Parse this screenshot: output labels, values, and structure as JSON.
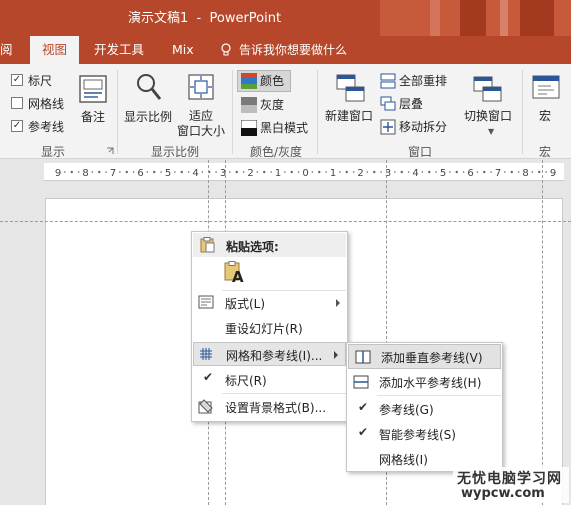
{
  "window": {
    "title": "演示文稿1  -  PowerPoint"
  },
  "tabs": [
    {
      "label": "阅"
    },
    {
      "label": "视图"
    },
    {
      "label": "开发工具"
    },
    {
      "label": "Mix"
    }
  ],
  "tell_me": "告诉我你想要做什么",
  "ribbon": {
    "show": {
      "ruler": "标尺",
      "gridlines": "网格线",
      "guides": "参考线",
      "notes": "备注",
      "group": "显示"
    },
    "zoom": {
      "zoom": "显示比例",
      "fit_line1": "适应",
      "fit_line2": "窗口大小",
      "group": "显示比例"
    },
    "color": {
      "color": "颜色",
      "grayscale": "灰度",
      "bw": "黑白模式",
      "group": "颜色/灰度"
    },
    "window": {
      "new_window": "新建窗口",
      "arrange_all": "全部重排",
      "cascade": "层叠",
      "move_split": "移动拆分",
      "switch": "切换窗口",
      "group": "窗口"
    },
    "macros": {
      "label": "宏",
      "group": "宏"
    }
  },
  "ruler_labels": [
    "9",
    "8",
    "7",
    "6",
    "5",
    "4",
    "3",
    "2",
    "1",
    "0",
    "1",
    "2",
    "3",
    "4",
    "5",
    "6",
    "7",
    "8",
    "9"
  ],
  "context_menu": {
    "paste_header": "粘贴选项:",
    "paste_icon_letter": "A",
    "items": [
      {
        "label": "版式(L)"
      },
      {
        "label": "重设幻灯片(R)"
      },
      {
        "label": "网格和参考线(I)..."
      },
      {
        "label": "标尺(R)"
      },
      {
        "label": "设置背景格式(B)..."
      }
    ]
  },
  "submenu": {
    "items": [
      {
        "label": "添加垂直参考线(V)"
      },
      {
        "label": "添加水平参考线(H)"
      },
      {
        "label": "参考线(G)"
      },
      {
        "label": "智能参考线(S)"
      },
      {
        "label": "网格线(I)"
      }
    ]
  },
  "watermark": {
    "line1": "无忧电脑学习网",
    "line2": "wypcw.com"
  },
  "colors": {
    "accent": "#b7472a",
    "ribbon_bg": "#f3f3f3"
  }
}
